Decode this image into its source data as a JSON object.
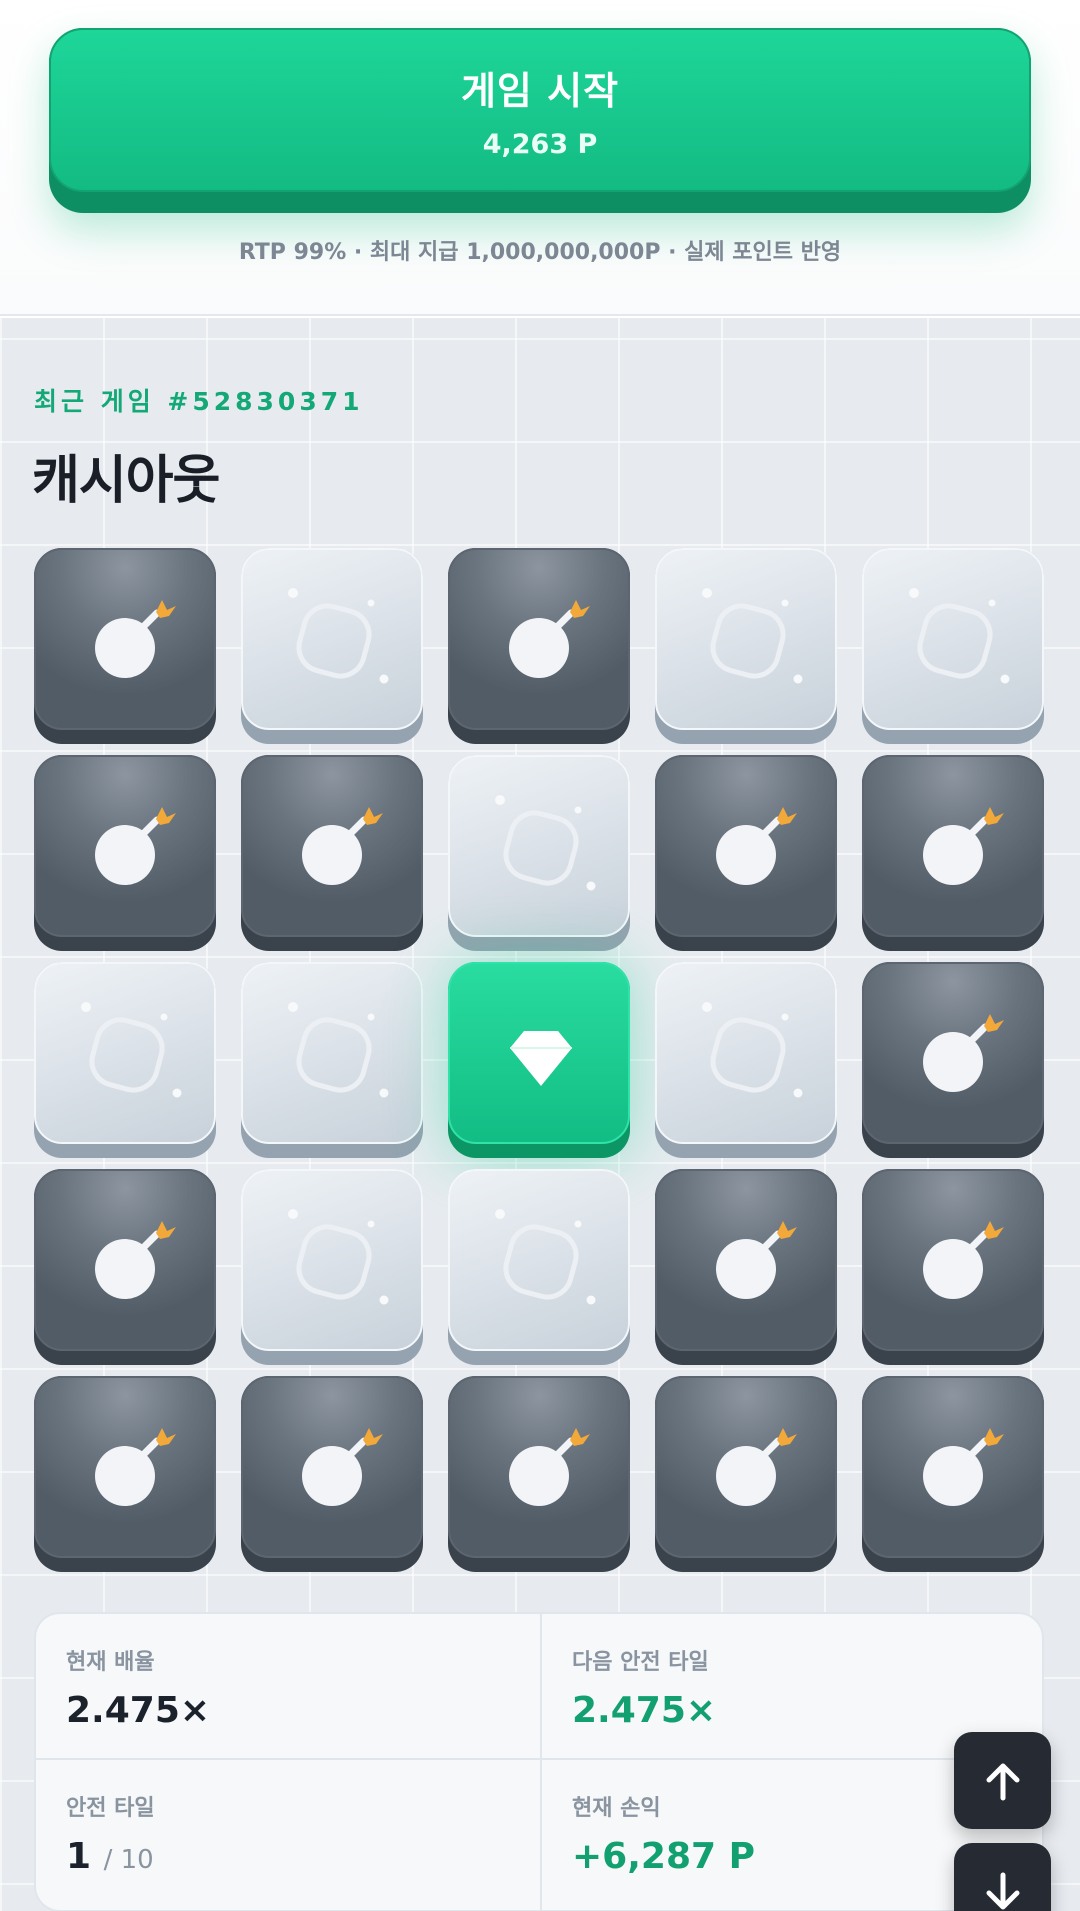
{
  "start": {
    "title": "게임 시작",
    "amount": "4,263 P",
    "info": "RTP 99% · 최대 지급 1,000,000,000P · 실제 포인트 반영"
  },
  "round": {
    "label": "최근 게임 #52830371",
    "title": "캐시아웃"
  },
  "board": {
    "rows": [
      [
        "bomb",
        "safe",
        "bomb",
        "safe",
        "safe"
      ],
      [
        "bomb",
        "bomb",
        "safe",
        "bomb",
        "bomb"
      ],
      [
        "safe",
        "safe",
        "gem",
        "safe",
        "bomb"
      ],
      [
        "bomb",
        "safe",
        "safe",
        "bomb",
        "bomb"
      ],
      [
        "bomb",
        "bomb",
        "bomb",
        "bomb",
        "bomb"
      ]
    ]
  },
  "stats": {
    "multiplier_label": "현재 배율",
    "multiplier_value": "2.475×",
    "next_label": "다음 안전 타일",
    "next_value": "2.475×",
    "safe_label": "안전 타일",
    "safe_count": "1",
    "safe_total": "/ 10",
    "profit_label": "현재 손익",
    "profit_value": "+6,287 P"
  },
  "icons": {
    "scroll_up": "arrow-up-icon",
    "scroll_down": "arrow-down-icon"
  },
  "colors": {
    "accent": "#13bb83",
    "bomb_tile": "#5a646e",
    "safe_tile": "#d9e0e7"
  }
}
